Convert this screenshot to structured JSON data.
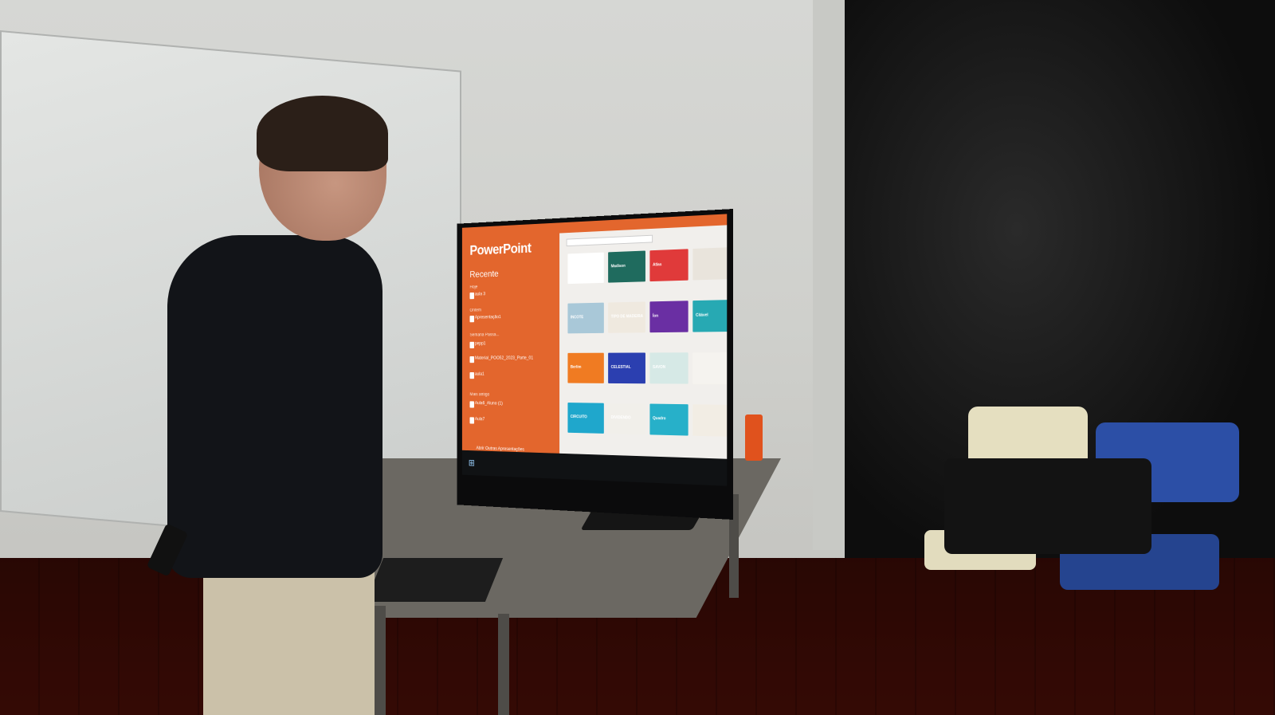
{
  "app": {
    "name": "PowerPoint",
    "recent_heading": "Recente",
    "open_other": "Abrir Outras Apresentações"
  },
  "recent": {
    "groups": [
      {
        "label": "Hoje",
        "files": [
          {
            "name": "aula 3"
          }
        ]
      },
      {
        "label": "Ontem",
        "files": [
          {
            "name": "Apresentação1"
          }
        ]
      },
      {
        "label": "Semana Passa...",
        "files": [
          {
            "name": "pepp1"
          },
          {
            "name": "Material_POO52_2023_Parte_01"
          },
          {
            "name": "aula1"
          }
        ]
      },
      {
        "label": "Mais antigo",
        "files": [
          {
            "name": "Aula6_Aluno (1)"
          },
          {
            "name": "Aula7"
          }
        ]
      }
    ]
  },
  "templates": [
    {
      "label": "",
      "color": "#ffffff"
    },
    {
      "label": "Madison",
      "color": "#1f6b5e"
    },
    {
      "label": "Atlas",
      "color": "#e03a3a"
    },
    {
      "label": "",
      "color": "#e9e4dc"
    },
    {
      "label": "INCOTE",
      "color": "#a9c8d8"
    },
    {
      "label": "TIPO DE MADEIRA",
      "color": "#efe9df"
    },
    {
      "label": "Íon",
      "color": "#6a2fa3"
    },
    {
      "label": "Citável",
      "color": "#27a9b3"
    },
    {
      "label": "Berlim",
      "color": "#f07b22"
    },
    {
      "label": "CELESTIAL",
      "color": "#2b3fb0"
    },
    {
      "label": "SAVON",
      "color": "#d6e9e6"
    },
    {
      "label": "",
      "color": "#f5f3ef"
    },
    {
      "label": "CIRCUITO",
      "color": "#1fa7cc"
    },
    {
      "label": "DIVIDENDO",
      "color": "#f1efea"
    },
    {
      "label": "Quadro",
      "color": "#27b0c9"
    },
    {
      "label": "",
      "color": "#f2ede4"
    }
  ],
  "colors": {
    "accent": "#e3662d"
  },
  "icons": {
    "start": "windows-start-icon",
    "file": "file-icon"
  }
}
